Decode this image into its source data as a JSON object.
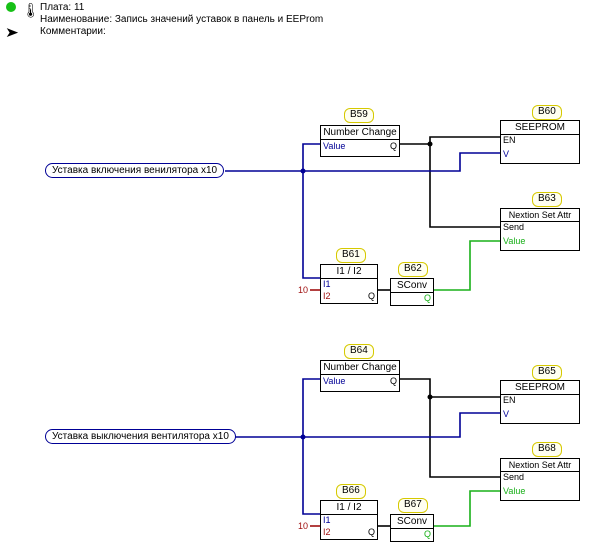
{
  "header": {
    "plate_label": "Плата:",
    "plate_value": "11",
    "name_label": "Наименование:",
    "name_value": "Запись значений уставок в панель и EEProm",
    "comment_label": "Комментарии:"
  },
  "sources": {
    "src1": "Уставка включения венилятора x10",
    "src2": "Уставка выключения вентилятора x10"
  },
  "constants": {
    "ten1": "10",
    "ten2": "10"
  },
  "tags": {
    "b59": "B59",
    "b60": "B60",
    "b61": "B61",
    "b62": "B62",
    "b63": "B63",
    "b64": "B64",
    "b65": "B65",
    "b66": "B66",
    "b67": "B67",
    "b68": "B68"
  },
  "blocks": {
    "numchg": {
      "title": "Number Change",
      "in": "Value",
      "out": "Q"
    },
    "seeprom": {
      "title": "SEEPROM",
      "en": "EN",
      "v": "V"
    },
    "nxt": {
      "title": "Nextion Set Attr",
      "send": "Send",
      "value": "Value"
    },
    "div": {
      "title": "I1 / I2",
      "i1": "I1",
      "i2": "I2",
      "out": "Q"
    },
    "sconv": {
      "title": "SConv",
      "out": "Q"
    }
  },
  "colors": {
    "blue": "#000096",
    "red": "#a01010",
    "green": "#18b018",
    "black": "#000000"
  }
}
